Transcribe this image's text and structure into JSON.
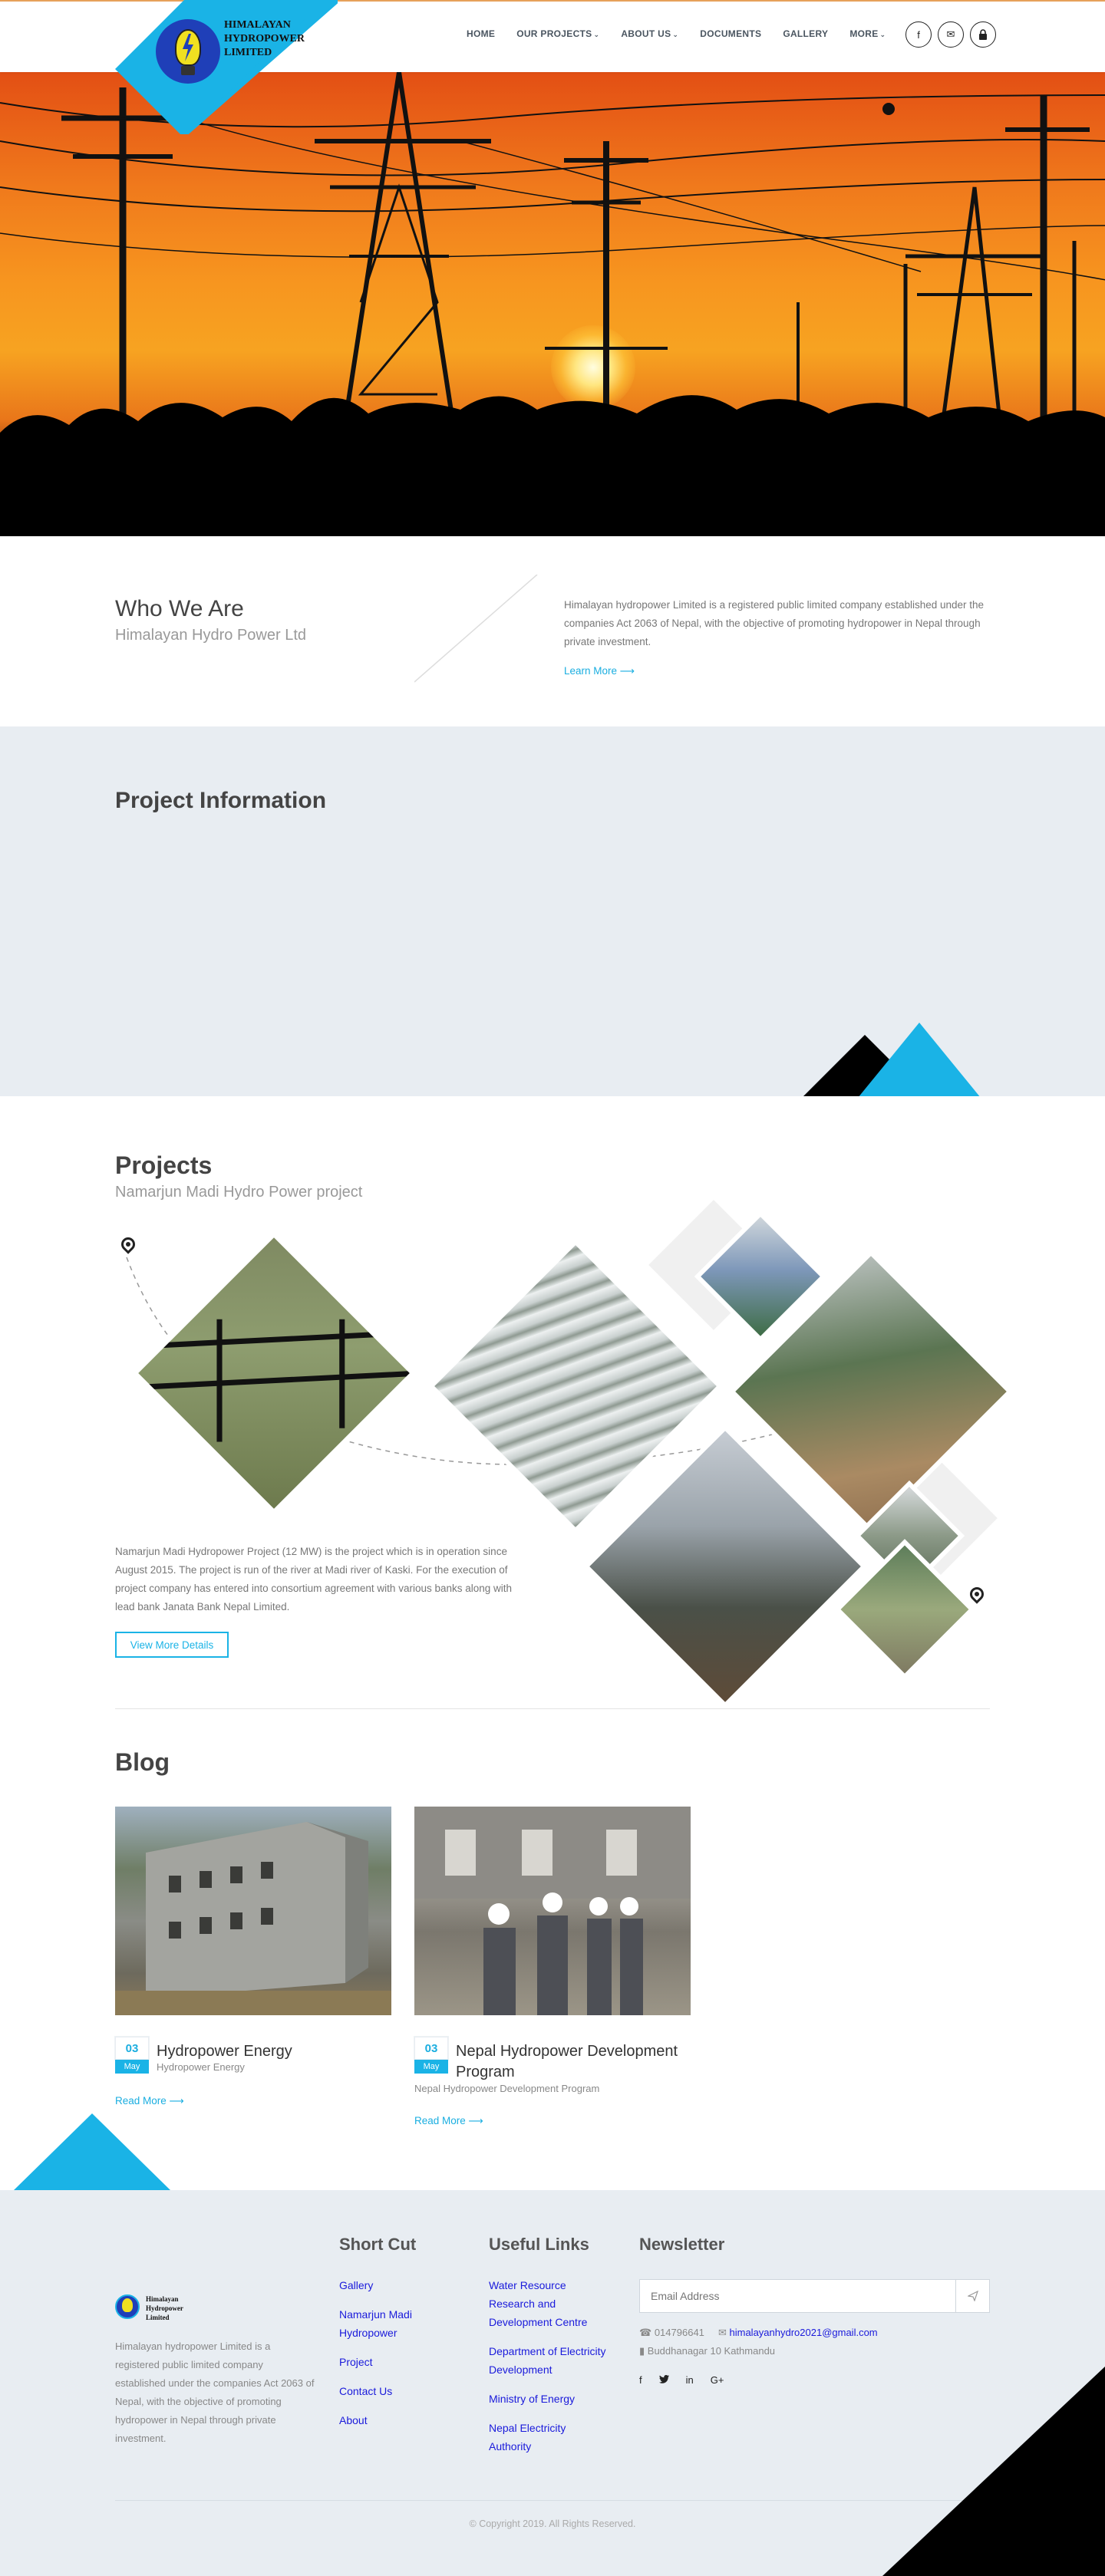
{
  "header": {
    "logo_text_line1": "HIMALAYAN",
    "logo_text_line2": "HYDROPOWER",
    "logo_text_line3": "LIMITED",
    "nav": [
      {
        "label": "HOME",
        "caret": ""
      },
      {
        "label": "OUR PROJECTS",
        "caret": "⌄"
      },
      {
        "label": "ABOUT US",
        "caret": "⌄"
      },
      {
        "label": "DOCUMENTS",
        "caret": ""
      },
      {
        "label": "GALLERY",
        "caret": ""
      },
      {
        "label": "MORE",
        "caret": "⌄"
      }
    ],
    "social": [
      {
        "icon": "facebook-icon",
        "glyph": "f"
      },
      {
        "icon": "envelope-icon",
        "glyph": "✉"
      },
      {
        "icon": "lock-icon",
        "glyph": "🔒"
      }
    ],
    "colors": {
      "accent": "#1ab3e6",
      "topline": "#e6a15a"
    }
  },
  "who": {
    "title": "Who We Are",
    "subtitle": "Himalayan Hydro Power Ltd",
    "text": "Himalayan hydropower Limited is a registered public limited company established under the companies Act 2063 of Nepal, with the objective of promoting hydropower in Nepal through private investment.",
    "more": "Learn More ⟶"
  },
  "project_info": {
    "title": "Project Information"
  },
  "projects": {
    "title": "Projects",
    "subtitle": "Namarjun Madi Hydro Power project",
    "text": "Namarjun Madi Hydropower Project (12 MW) is the project which is in operation since August 2015. The project is run of the river at Madi river of Kaski. For the execution of project company has entered into consortium agreement with various banks along with lead bank Janata Bank Nepal Limited.",
    "button": "View More Details"
  },
  "blog": {
    "title": "Blog",
    "posts": [
      {
        "day": "03",
        "month": "May",
        "title": "Hydropower Energy",
        "category": "Hydropower Energy",
        "more": "Read More ⟶"
      },
      {
        "day": "03",
        "month": "May",
        "title": "Nepal Hydropower Development Program",
        "category": "Nepal Hydropower Development Program",
        "more": "Read More ⟶"
      }
    ]
  },
  "footer": {
    "logo_line1": "Himalayan",
    "logo_line2": "Hydropower",
    "logo_line3": "Limited",
    "about": "Himalayan hydropower Limited is a registered public limited company established under the companies Act 2063 of Nepal, with the objective of promoting hydropower in Nepal through private investment.",
    "shortcut_title": "Short Cut",
    "shortcut": [
      "Gallery",
      "Namarjun Madi Hydropower",
      "Project",
      "Contact Us",
      "About"
    ],
    "links_title": "Useful Links",
    "links": [
      "Water Resource Research and Development Centre",
      "Department of Electricity Development",
      "Ministry of Energy",
      "Nepal Electricity Authority"
    ],
    "newsletter_title": "Newsletter",
    "email_placeholder": "Email Address",
    "phone": "014796641",
    "email": "himalayanhydro2021@gmail.com",
    "address": "Buddhanagar 10 Kathmandu",
    "social": [
      {
        "icon": "facebook-icon",
        "glyph": "f"
      },
      {
        "icon": "twitter-icon",
        "glyph": "🐦"
      },
      {
        "icon": "linkedin-icon",
        "glyph": "in"
      },
      {
        "icon": "google-plus-icon",
        "glyph": "G+"
      }
    ],
    "copyright": "© Copyright 2019. All Rights Reserved."
  }
}
